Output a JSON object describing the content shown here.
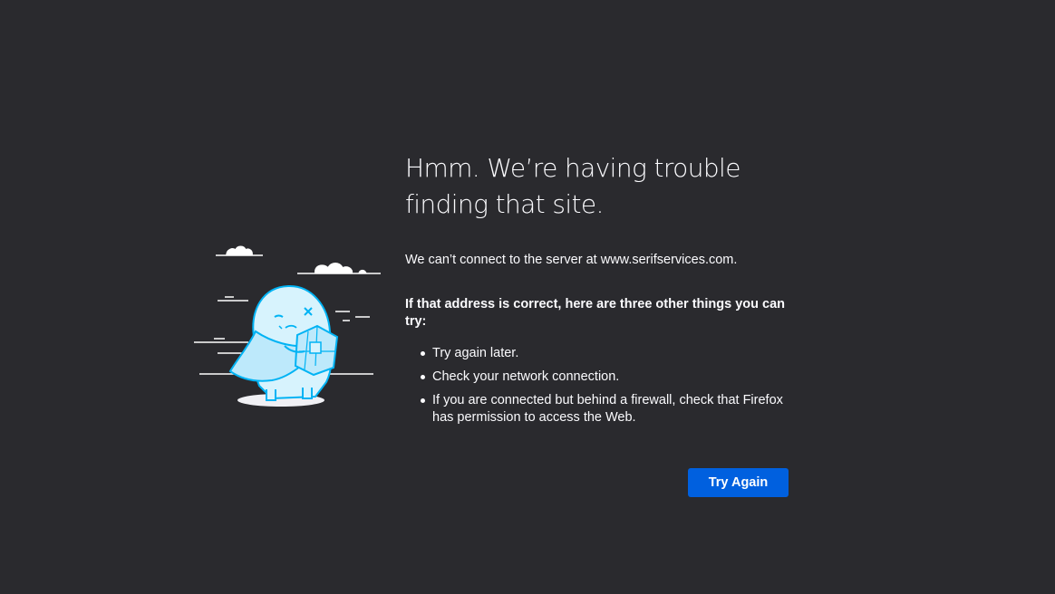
{
  "error": {
    "title": "Hmm. We’re having trouble finding that site.",
    "server_message": "We can’t connect to the server at www.serifservices.com.",
    "subheading": "If that address is correct, here are three other things you can try:",
    "suggestions": [
      "Try again later.",
      "Check your network connection.",
      "If you are connected but behind a firewall, check that Firefox has permission to access the Web."
    ],
    "try_again_label": "Try Again"
  },
  "colors": {
    "background": "#2a2a2e",
    "text": "#fbfbfe",
    "button": "#0060df",
    "illustration_accent": "#00b3f4"
  }
}
